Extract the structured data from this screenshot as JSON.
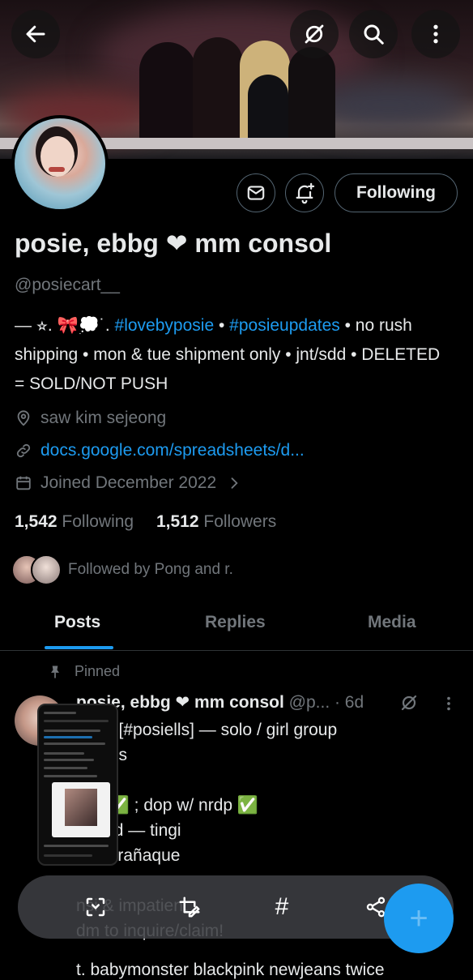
{
  "header": {
    "back_icon": "arrow-left-icon",
    "grok_icon": "grok-slash-icon",
    "search_icon": "search-icon",
    "more_icon": "more-vertical-icon"
  },
  "profile": {
    "display_name": "posie, ebbg ❤ mm consol",
    "handle": "@posiecart__",
    "bio_prefix": "— ⭐︎. 🎀💭˙. ",
    "bio_tag1": "#lovebyposie",
    "bio_mid": " • ",
    "bio_tag2": "#posieupdates",
    "bio_rest": " • no rush shipping • mon & tue shipment only • jnt/sdd • DELETED = SOLD/NOT PUSH",
    "location": "saw kim sejeong",
    "website": "docs.google.com/spreadsheets/d...",
    "joined": "Joined December 2022",
    "following_count": "1,542",
    "following_label": "Following",
    "followers_count": "1,512",
    "followers_label": "Followers",
    "followed_by": "Followed by Pong and r."
  },
  "actions": {
    "follow_label": "Following",
    "message_icon": "mail-icon",
    "notify_icon": "bell-plus-icon"
  },
  "tabs": [
    {
      "label": "Posts",
      "active": true
    },
    {
      "label": "Replies",
      "active": false
    },
    {
      "label": "Media",
      "active": false
    }
  ],
  "pinned_post": {
    "pinned_label": "Pinned",
    "author": "posie, ebbg ❤ mm consol",
    "handle_time": " @p... · 6d",
    "body": "fb ph [#posiells] — solo / girl group\nocards\n\nayo ✅ ; dop w/ nrdp ✅\nnhand — tingi\nc : parañaque\n\nnsi & impatient\ndm to inquire/claim!",
    "tail": "t. babymonster blackpink newjeans twice"
  },
  "bottom_toolbar": {
    "icons": [
      "scan-icon",
      "edit-image-icon",
      "hashtag-icon",
      "share-icon"
    ],
    "hashtag_glyph": "#"
  },
  "fab": {
    "label": "+"
  },
  "colors": {
    "accent": "#1d9bf0",
    "muted": "#71767b",
    "text": "#e7e9ea",
    "background": "#000000"
  }
}
